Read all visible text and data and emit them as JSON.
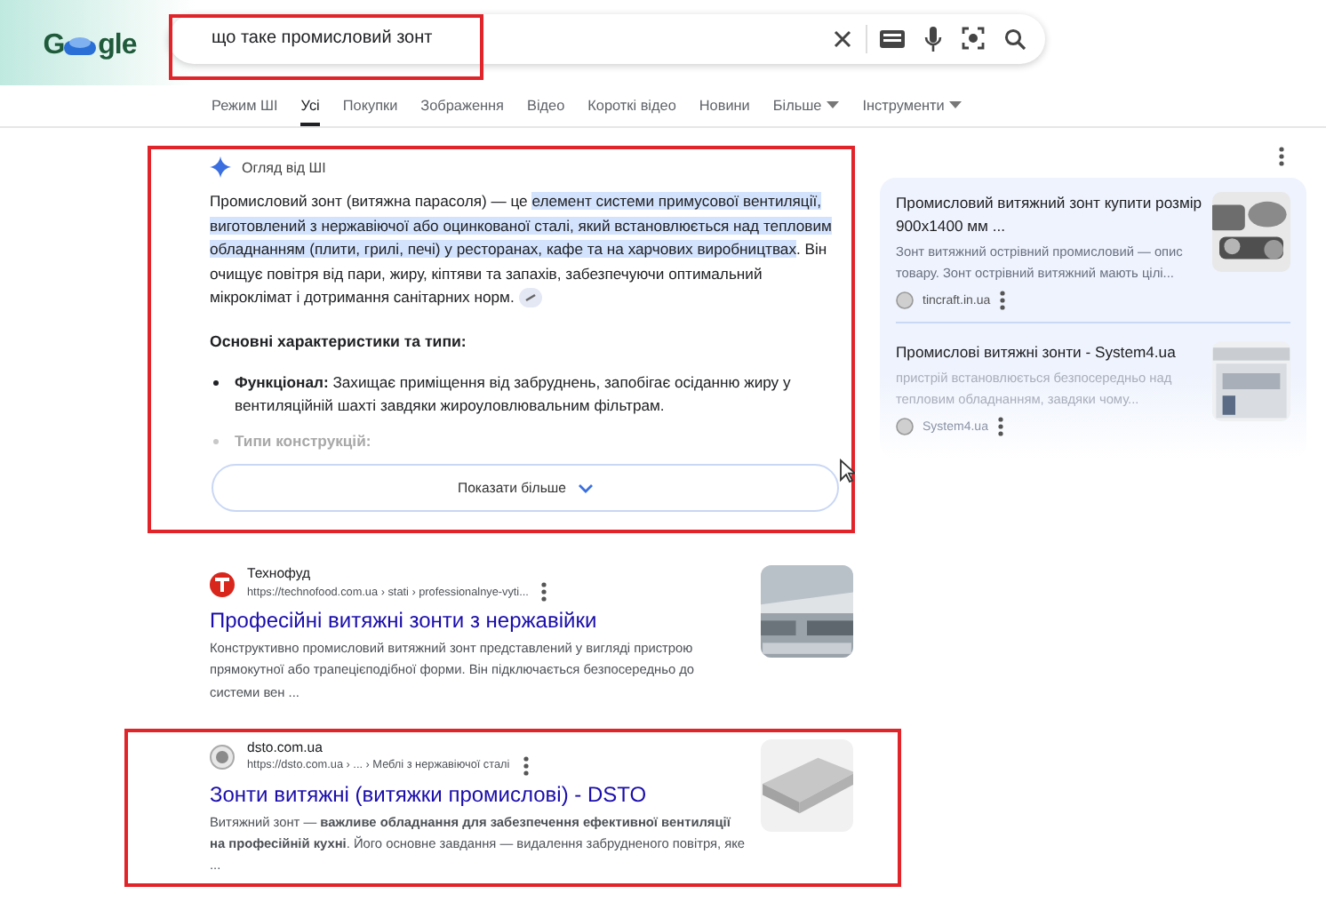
{
  "logo": {
    "left": "G",
    "right": "gle"
  },
  "search": {
    "value": "що таке промисловий зонт",
    "highlighted": true
  },
  "tabs": [
    {
      "label": "Режим ШІ",
      "selected": false,
      "menu": false
    },
    {
      "label": "Усі",
      "selected": true,
      "menu": false
    },
    {
      "label": "Покупки",
      "selected": false,
      "menu": false
    },
    {
      "label": "Зображення",
      "selected": false,
      "menu": false
    },
    {
      "label": "Відео",
      "selected": false,
      "menu": false
    },
    {
      "label": "Короткі відео",
      "selected": false,
      "menu": false
    },
    {
      "label": "Новини",
      "selected": false,
      "menu": false
    },
    {
      "label": "Більше",
      "selected": false,
      "menu": true
    },
    {
      "label": "Інструменти",
      "selected": false,
      "menu": true
    }
  ],
  "ai_overview": {
    "title": "Огляд від ШІ",
    "highlighted": true,
    "paragraph": [
      {
        "text": "Промисловий зонт (витяжна парасоля) — це ",
        "highlighted": false
      },
      {
        "text": "елемент системи примусової вентиляції, виготовлений з нержавіючої або оцинкованої сталі, який встановлюється над тепловим обладнанням (плити, грилі, печі) у ресторанах, кафе та на харчових виробництвах",
        "highlighted": true
      },
      {
        "text": ". Він очищує повітря від пари, жиру, кіптяви та запахів, забезпечуючи оптимальний мікроклімат і дотримання санітарних норм.",
        "highlighted": false
      }
    ],
    "heading": "Основні характеристики та типи:",
    "bullets": [
      {
        "text": "**Функціонал:** Захищає приміщення від забруднень, запобігає осіданню жиру у вентиляційній шахті завдяки жироуловлювальним фільтрам.",
        "faded": false
      },
      {
        "text": "**Типи конструкцій:**",
        "faded": true
      }
    ],
    "more_button": "Показати більше"
  },
  "side_cards": [
    {
      "title": "Промисловий витяжний зонт купити розмір 900x1400 мм ...",
      "snippet": "Зонт витяжний острівний промисловий — опис товару. Зонт острівний витяжний мають цілі...",
      "source": "tincraft.in.ua",
      "faded": false
    },
    {
      "title": "Промислові витяжні зонти - System4.ua",
      "snippet": "пристрій встановлюється безпосередньо над тепловим обладнанням, завдяки чому...",
      "source": "System4.ua",
      "faded": true
    }
  ],
  "results": [
    {
      "kind": "red",
      "site": "Технофуд",
      "url": "https://technofood.com.ua › stati › professionalnye-vyti...",
      "title": "Професійні витяжні зонти з нержавійки",
      "snippet": "Конструктивно промисловий витяжний зонт представлений у вигляді пристрою прямокутної або трапецієподібної форми. Він підключається безпосередньо до системи вен ...",
      "highlighted": false
    },
    {
      "kind": "grey",
      "site": "dsto.com.ua",
      "url": "https://dsto.com.ua › ... › Меблі з нержавіючої сталі",
      "title": "Зонти витяжні (витяжки промислові) - DSTO",
      "snippet": "Витяжний зонт — **важливе обладнання для забезпечення ефективної вентиляції на професійній кухні**. Його основне завдання — видалення забрудненого повітря, яке ...",
      "highlighted": true
    }
  ]
}
